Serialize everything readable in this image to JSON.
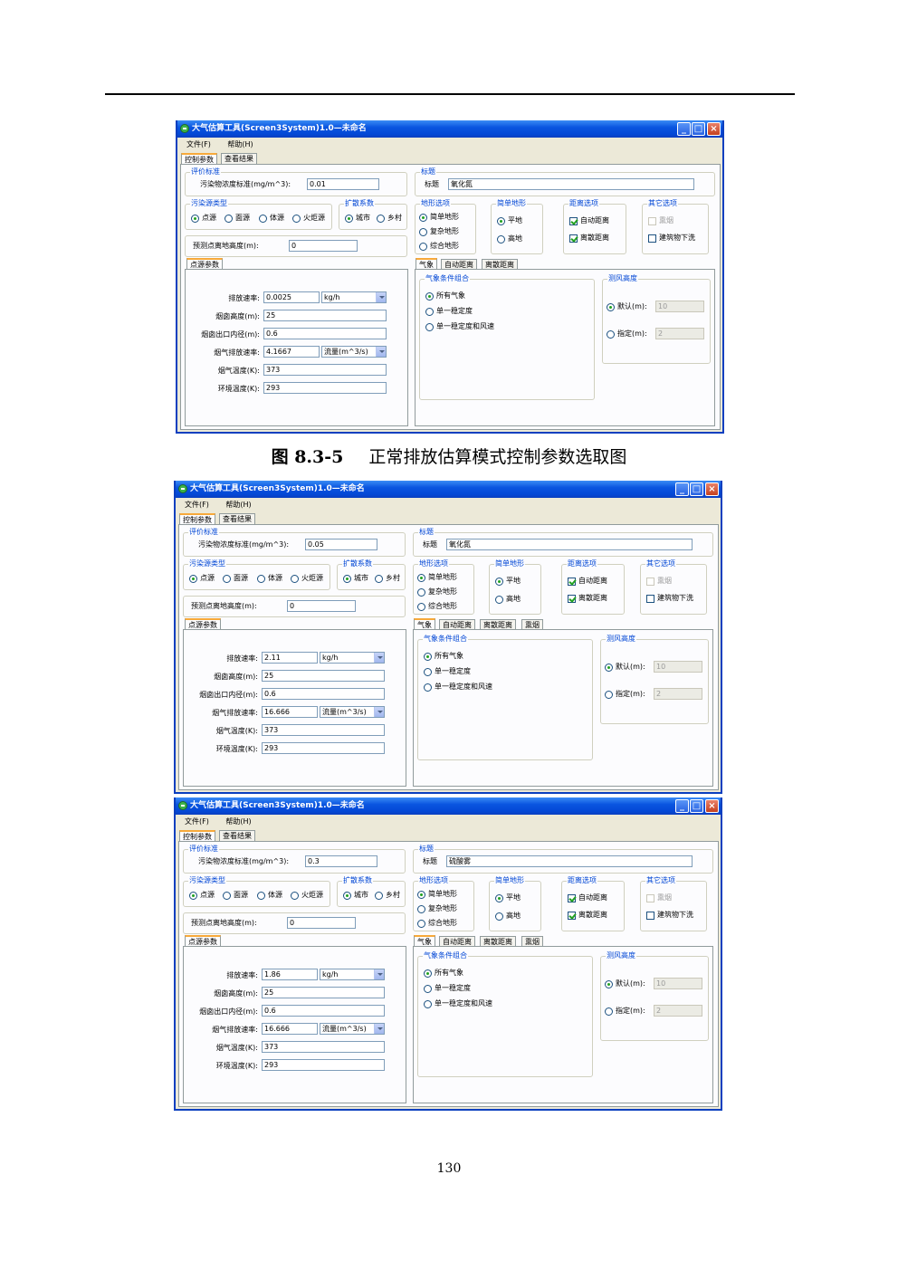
{
  "caption": {
    "number": "图 8.3-5",
    "text": "正常排放估算模式控制参数选取图"
  },
  "page_number": "130",
  "labels": {
    "title": "大气估算工具(Screen3System)1.0—未命名",
    "menu_file": "文件(F)",
    "menu_help": "帮助(H)",
    "tab_control": "控制参数",
    "tab_results": "查看结果",
    "grp_eval": "评价标准",
    "conc_std": "污染物浓度标准(mg/m^3):",
    "grp_title": "标题",
    "title_label": "标题",
    "grp_source": "污染源类型",
    "src_point": "点源",
    "src_area": "面源",
    "src_volume": "体源",
    "src_flare": "火炬源",
    "grp_disp": "扩散系数",
    "disp_urban": "城市",
    "disp_rural": "乡村",
    "grp_terrain": "地形选项",
    "ter_simple": "简单地形",
    "ter_complex": "复杂地形",
    "ter_combined": "综合地形",
    "grp_simple": "简单地形",
    "flat": "平地",
    "elevated": "高地",
    "grp_dist": "距离选项",
    "auto_dist": "自动距离",
    "discrete_dist": "离散距离",
    "grp_other": "其它选项",
    "fumigation": "熏烟",
    "downwash": "建筑物下洗",
    "receptor_height": "预测点离地高度(m):",
    "tab_point_params": "点源参数",
    "emission_rate": "排放速率:",
    "stack_height": "烟囱高度(m):",
    "stack_diameter": "烟囱出口内径(m):",
    "gas_flow": "烟气排放速率:",
    "gas_temp": "烟气温度(K):",
    "ambient_temp": "环境温度(K):",
    "tab_met": "气象",
    "tab_auto": "自动距离",
    "tab_discrete": "离散距离",
    "tab_fum": "熏烟",
    "grp_met": "气象条件组合",
    "met_all": "所有气象",
    "met_single": "单一稳定度",
    "met_single_wind": "单一稳定度和风速",
    "grp_anem": "测风高度",
    "anem_default": "默认(m):",
    "anem_specify": "指定(m):"
  },
  "windows": [
    {
      "concentration_standard": "0.01",
      "title": "氧化氮",
      "receptor_height": "0",
      "emission_rate": "0.0025",
      "rate_unit": "kg/h",
      "stack_height": "25",
      "stack_diameter": "0.6",
      "gas_flow": "4.1667",
      "flow_unit": "流量(m^3/s)",
      "gas_temp": "373",
      "ambient_temp": "293",
      "anem_default": "10",
      "anem_specify": "2",
      "fumigation_tab": false
    },
    {
      "concentration_standard": "0.05",
      "title": "氧化氮",
      "receptor_height": "0",
      "emission_rate": "2.11",
      "rate_unit": "kg/h",
      "stack_height": "25",
      "stack_diameter": "0.6",
      "gas_flow": "16.666",
      "flow_unit": "流量(m^3/s)",
      "gas_temp": "373",
      "ambient_temp": "293",
      "anem_default": "10",
      "anem_specify": "2",
      "fumigation_tab": true
    },
    {
      "concentration_standard": "0.3",
      "title": "硫酸雾",
      "receptor_height": "0",
      "emission_rate": "1.86",
      "rate_unit": "kg/h",
      "stack_height": "25",
      "stack_diameter": "0.6",
      "gas_flow": "16.666",
      "flow_unit": "流量(m^3/s)",
      "gas_temp": "373",
      "ambient_temp": "293",
      "anem_default": "10",
      "anem_specify": "2",
      "fumigation_tab": true
    }
  ],
  "state": {
    "source_type": "点源",
    "dispersion": "城市",
    "terrain": "简单地形",
    "simple_terrain": "平地",
    "auto_distance_checked": true,
    "discrete_distance_checked": true,
    "fumigation_checked": false,
    "downwash_checked": false,
    "met_condition": "所有气象",
    "anemometer": "默认"
  }
}
